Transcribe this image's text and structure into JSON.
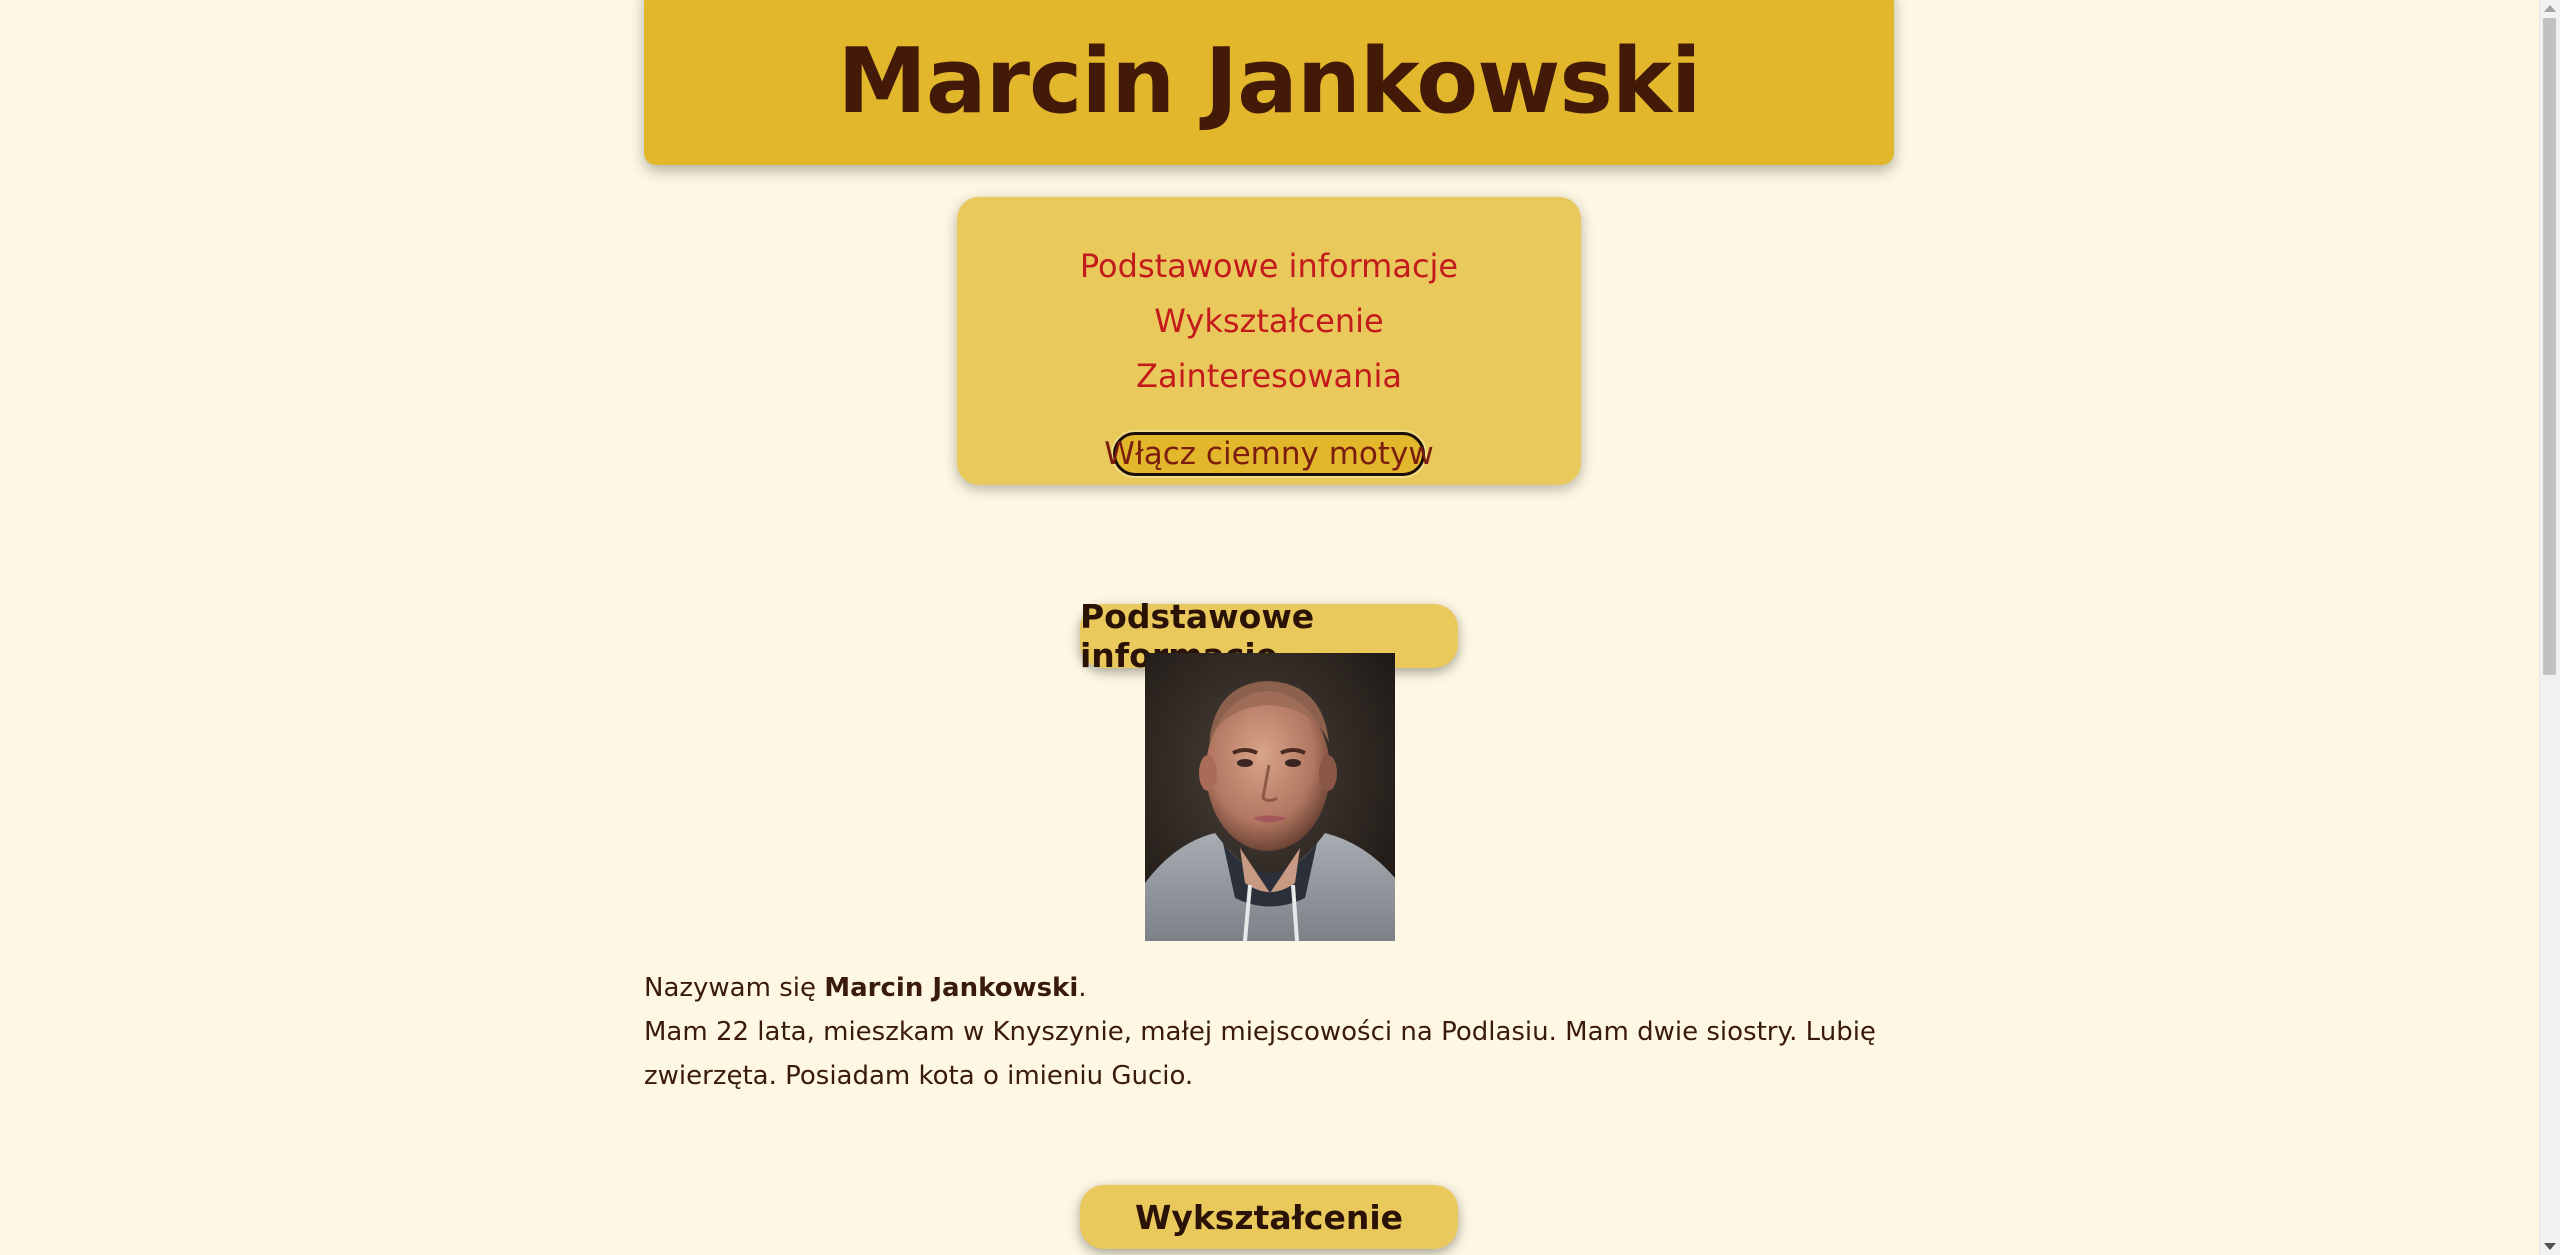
{
  "header": {
    "title": "Marcin Jankowski"
  },
  "nav": {
    "items": [
      {
        "label": "Podstawowe informacje"
      },
      {
        "label": "Wykształcenie"
      },
      {
        "label": "Zainteresowania"
      }
    ],
    "theme_button": "Włącz ciemny motyw"
  },
  "sections": {
    "basic": {
      "title": "Podstawowe informacje"
    },
    "education": {
      "title": "Wykształcenie"
    }
  },
  "bio": {
    "intro_prefix": "Nazywam się ",
    "name": "Marcin Jankowski",
    "intro_suffix": ".",
    "text": "Mam 22 lata, mieszkam w Knyszynie, małej miejscowości na Podlasiu. Mam dwie siostry. Lubię zwierzęta. Posiadam kota o imieniu Gucio."
  },
  "colors": {
    "page_bg": "#fdf7e3",
    "header_bg": "#e2b72c",
    "panel_bg": "#eac95c",
    "link": "#c31b1b",
    "text": "#3a1a0a"
  }
}
